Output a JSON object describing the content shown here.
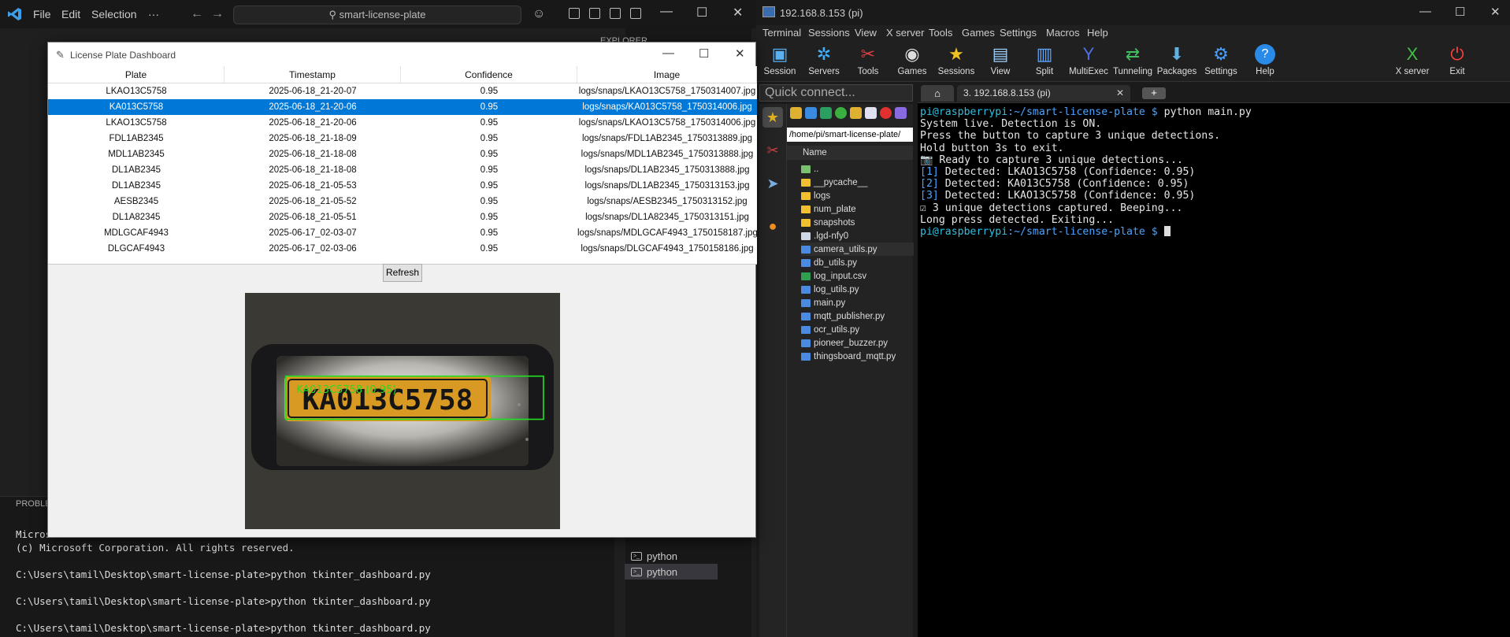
{
  "vscode": {
    "menu": [
      "File",
      "Edit",
      "Selection",
      "···"
    ],
    "search": "smart-license-plate",
    "explorer_header": "EXPLORER",
    "panel_header": "PROBLE",
    "terminal_lines": [
      "Micros",
      "(c) Microsoft Corporation. All rights reserved.",
      "",
      "C:\\Users\\tamil\\Desktop\\smart-license-plate>python tkinter_dashboard.py",
      "",
      "C:\\Users\\tamil\\Desktop\\smart-license-plate>python tkinter_dashboard.py",
      "",
      "C:\\Users\\tamil\\Desktop\\smart-license-plate>python tkinter_dashboard.py"
    ],
    "terminal_list": [
      {
        "label": "python",
        "selected": false
      },
      {
        "label": "python",
        "selected": true
      }
    ]
  },
  "dashboard": {
    "title": "License Plate Dashboard",
    "columns": [
      "Plate",
      "Timestamp",
      "Confidence",
      "Image"
    ],
    "rows": [
      [
        "LKAO13C5758",
        "2025-06-18_21-20-07",
        "0.95",
        "logs/snaps/LKAO13C5758_1750314007.jpg"
      ],
      [
        "KA013C5758",
        "2025-06-18_21-20-06",
        "0.95",
        "logs/snaps/KA013C5758_1750314006.jpg"
      ],
      [
        "LKAO13C5758",
        "2025-06-18_21-20-06",
        "0.95",
        "logs/snaps/LKAO13C5758_1750314006.jpg"
      ],
      [
        "FDL1AB2345",
        "2025-06-18_21-18-09",
        "0.95",
        "logs/snaps/FDL1AB2345_1750313889.jpg"
      ],
      [
        "MDL1AB2345",
        "2025-06-18_21-18-08",
        "0.95",
        "logs/snaps/MDL1AB2345_1750313888.jpg"
      ],
      [
        "DL1AB2345",
        "2025-06-18_21-18-08",
        "0.95",
        "logs/snaps/DL1AB2345_1750313888.jpg"
      ],
      [
        "DL1AB2345",
        "2025-06-18_21-05-53",
        "0.95",
        "logs/snaps/DL1AB2345_1750313153.jpg"
      ],
      [
        "AESB2345",
        "2025-06-18_21-05-52",
        "0.95",
        "logs/snaps/AESB2345_1750313152.jpg"
      ],
      [
        "DL1A82345",
        "2025-06-18_21-05-51",
        "0.95",
        "logs/snaps/DL1A82345_1750313151.jpg"
      ],
      [
        "MDLGCAF4943",
        "2025-06-17_02-03-07",
        "0.95",
        "logs/snaps/MDLGCAF4943_1750158187.jpg"
      ],
      [
        "DLGCAF4943",
        "2025-06-17_02-03-06",
        "0.95",
        "logs/snaps/DLGCAF4943_1750158186.jpg"
      ]
    ],
    "selected_row": 1,
    "refresh_label": "Refresh",
    "image": {
      "plate_text": "KA013C5758",
      "overlay_label": "KA013C5758 (0.95)",
      "box_color": "#22dd22"
    }
  },
  "moba": {
    "title": "192.168.8.153 (pi)",
    "menu": [
      "Terminal",
      "Sessions",
      "View",
      "X server",
      "Tools",
      "Games",
      "Settings",
      "Macros",
      "Help"
    ],
    "tools": [
      {
        "label": "Session",
        "icon": "monitor-icon"
      },
      {
        "label": "Servers",
        "icon": "servers-icon"
      },
      {
        "label": "Tools",
        "icon": "tools-icon"
      },
      {
        "label": "Games",
        "icon": "gamepad-icon"
      },
      {
        "label": "Sessions",
        "icon": "star-icon"
      },
      {
        "label": "View",
        "icon": "view-icon"
      },
      {
        "label": "Split",
        "icon": "split-icon"
      },
      {
        "label": "MultiExec",
        "icon": "multiexec-icon"
      },
      {
        "label": "Tunneling",
        "icon": "tunneling-icon"
      },
      {
        "label": "Packages",
        "icon": "packages-icon"
      },
      {
        "label": "Settings",
        "icon": "settings-icon"
      },
      {
        "label": "Help",
        "icon": "help-icon"
      }
    ],
    "tools_right": [
      {
        "label": "X server",
        "icon": "xserver-icon"
      },
      {
        "label": "Exit",
        "icon": "power-icon"
      }
    ],
    "quick_connect": "Quick connect...",
    "session_tab": "3. 192.168.8.153 (pi)",
    "sftp_path": "/home/pi/smart-license-plate/",
    "name_header": "Name",
    "files": [
      {
        "name": "..",
        "kind": "up"
      },
      {
        "name": "__pycache__",
        "kind": "folder"
      },
      {
        "name": "logs",
        "kind": "folder"
      },
      {
        "name": "num_plate",
        "kind": "folder"
      },
      {
        "name": "snapshots",
        "kind": "folder"
      },
      {
        "name": ".lgd-nfy0",
        "kind": "file"
      },
      {
        "name": "camera_utils.py",
        "kind": "py"
      },
      {
        "name": "db_utils.py",
        "kind": "py"
      },
      {
        "name": "log_input.csv",
        "kind": "csv"
      },
      {
        "name": "log_utils.py",
        "kind": "py"
      },
      {
        "name": "main.py",
        "kind": "py"
      },
      {
        "name": "mqtt_publisher.py",
        "kind": "py"
      },
      {
        "name": "ocr_utils.py",
        "kind": "py"
      },
      {
        "name": "pioneer_buzzer.py",
        "kind": "py"
      },
      {
        "name": "thingsboard_mqtt.py",
        "kind": "py"
      }
    ],
    "terminal": {
      "prompt_user": "pi@raspberrypi",
      "prompt_path": ":~/smart-license-plate $",
      "command": " python main.py",
      "lines": [
        "System live. Detection is ON.",
        "Press the button to capture 3 unique detections.",
        "Hold button 3s to exit.",
        "📷 Ready to capture 3 unique detections..."
      ],
      "detections": [
        {
          "idx": "[1]",
          "text": " Detected: LKAO13C5758 (Confidence: 0.95)"
        },
        {
          "idx": "[2]",
          "text": " Detected: KA013C5758 (Confidence: 0.95)"
        },
        {
          "idx": "[3]",
          "text": " Detected: LKAO13C5758 (Confidence: 0.95)"
        }
      ],
      "after": [
        "☑ 3 unique detections captured. Beeping...",
        "Long press detected. Exiting..."
      ]
    }
  }
}
